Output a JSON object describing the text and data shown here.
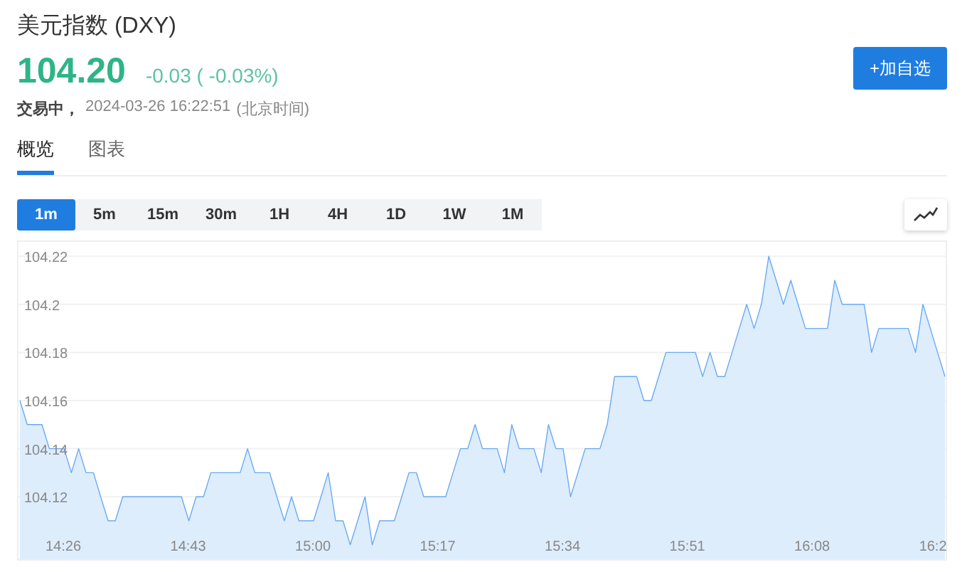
{
  "header": {
    "title": "美元指数 (DXY)",
    "price": "104.20",
    "change": "-0.03 ( -0.03%)",
    "status": "交易中，",
    "timestamp": "2024-03-26 16:22:51",
    "timezone": "(北京时间)"
  },
  "watch_button": "+加自选",
  "tabs": [
    {
      "label": "概览",
      "selected": true
    },
    {
      "label": "图表",
      "selected": false
    }
  ],
  "periods": [
    {
      "label": "1m",
      "selected": true
    },
    {
      "label": "5m",
      "selected": false
    },
    {
      "label": "15m",
      "selected": false
    },
    {
      "label": "30m",
      "selected": false
    },
    {
      "label": "1H",
      "selected": false
    },
    {
      "label": "4H",
      "selected": false
    },
    {
      "label": "1D",
      "selected": false
    },
    {
      "label": "1W",
      "selected": false
    },
    {
      "label": "1M",
      "selected": false
    }
  ],
  "chart_data": {
    "type": "area",
    "grid": true,
    "ylim": [
      104.094,
      104.226
    ],
    "yticks": [
      104.12,
      104.14,
      104.16,
      104.18,
      104.2,
      104.22
    ],
    "categories": [
      null,
      null,
      null,
      null,
      null,
      null,
      "14:26",
      null,
      null,
      null,
      null,
      null,
      null,
      null,
      null,
      null,
      null,
      null,
      null,
      null,
      null,
      null,
      null,
      "14:43",
      null,
      null,
      null,
      null,
      null,
      null,
      null,
      null,
      null,
      null,
      null,
      null,
      null,
      null,
      null,
      null,
      "15:00",
      null,
      null,
      null,
      null,
      null,
      null,
      null,
      null,
      null,
      null,
      null,
      null,
      null,
      null,
      null,
      null,
      "15:17",
      null,
      null,
      null,
      null,
      null,
      null,
      null,
      null,
      null,
      null,
      null,
      null,
      null,
      null,
      null,
      null,
      "15:34",
      null,
      null,
      null,
      null,
      null,
      null,
      null,
      null,
      null,
      null,
      null,
      null,
      null,
      null,
      null,
      null,
      "15:51",
      null,
      null,
      null,
      null,
      null,
      null,
      null,
      null,
      null,
      null,
      null,
      null,
      null,
      null,
      null,
      null,
      "16:08",
      null,
      null,
      null,
      null,
      null,
      null,
      null,
      null,
      null,
      null,
      null,
      null,
      null,
      null,
      null,
      null,
      "16:2",
      null
    ],
    "series": [
      {
        "color": "#6aaaf5",
        "values": [
          104.16,
          104.15,
          104.15,
          104.15,
          104.14,
          104.14,
          104.14,
          104.13,
          104.14,
          104.13,
          104.13,
          104.12,
          104.11,
          104.11,
          104.12,
          104.12,
          104.12,
          104.12,
          104.12,
          104.12,
          104.12,
          104.12,
          104.12,
          104.11,
          104.12,
          104.12,
          104.13,
          104.13,
          104.13,
          104.13,
          104.13,
          104.14,
          104.13,
          104.13,
          104.13,
          104.12,
          104.11,
          104.12,
          104.11,
          104.11,
          104.11,
          104.12,
          104.13,
          104.11,
          104.11,
          104.1,
          104.11,
          104.12,
          104.1,
          104.11,
          104.11,
          104.11,
          104.12,
          104.13,
          104.13,
          104.12,
          104.12,
          104.12,
          104.12,
          104.13,
          104.14,
          104.14,
          104.15,
          104.14,
          104.14,
          104.14,
          104.13,
          104.15,
          104.14,
          104.14,
          104.14,
          104.13,
          104.15,
          104.14,
          104.14,
          104.12,
          104.13,
          104.14,
          104.14,
          104.14,
          104.15,
          104.17,
          104.17,
          104.17,
          104.17,
          104.16,
          104.16,
          104.17,
          104.18,
          104.18,
          104.18,
          104.18,
          104.18,
          104.17,
          104.18,
          104.17,
          104.17,
          104.18,
          104.19,
          104.2,
          104.19,
          104.2,
          104.22,
          104.21,
          104.2,
          104.21,
          104.2,
          104.19,
          104.19,
          104.19,
          104.19,
          104.21,
          104.2,
          104.2,
          104.2,
          104.2,
          104.18,
          104.19,
          104.19,
          104.19,
          104.19,
          104.19,
          104.18,
          104.2,
          104.19,
          104.18,
          104.17
        ]
      }
    ]
  }
}
